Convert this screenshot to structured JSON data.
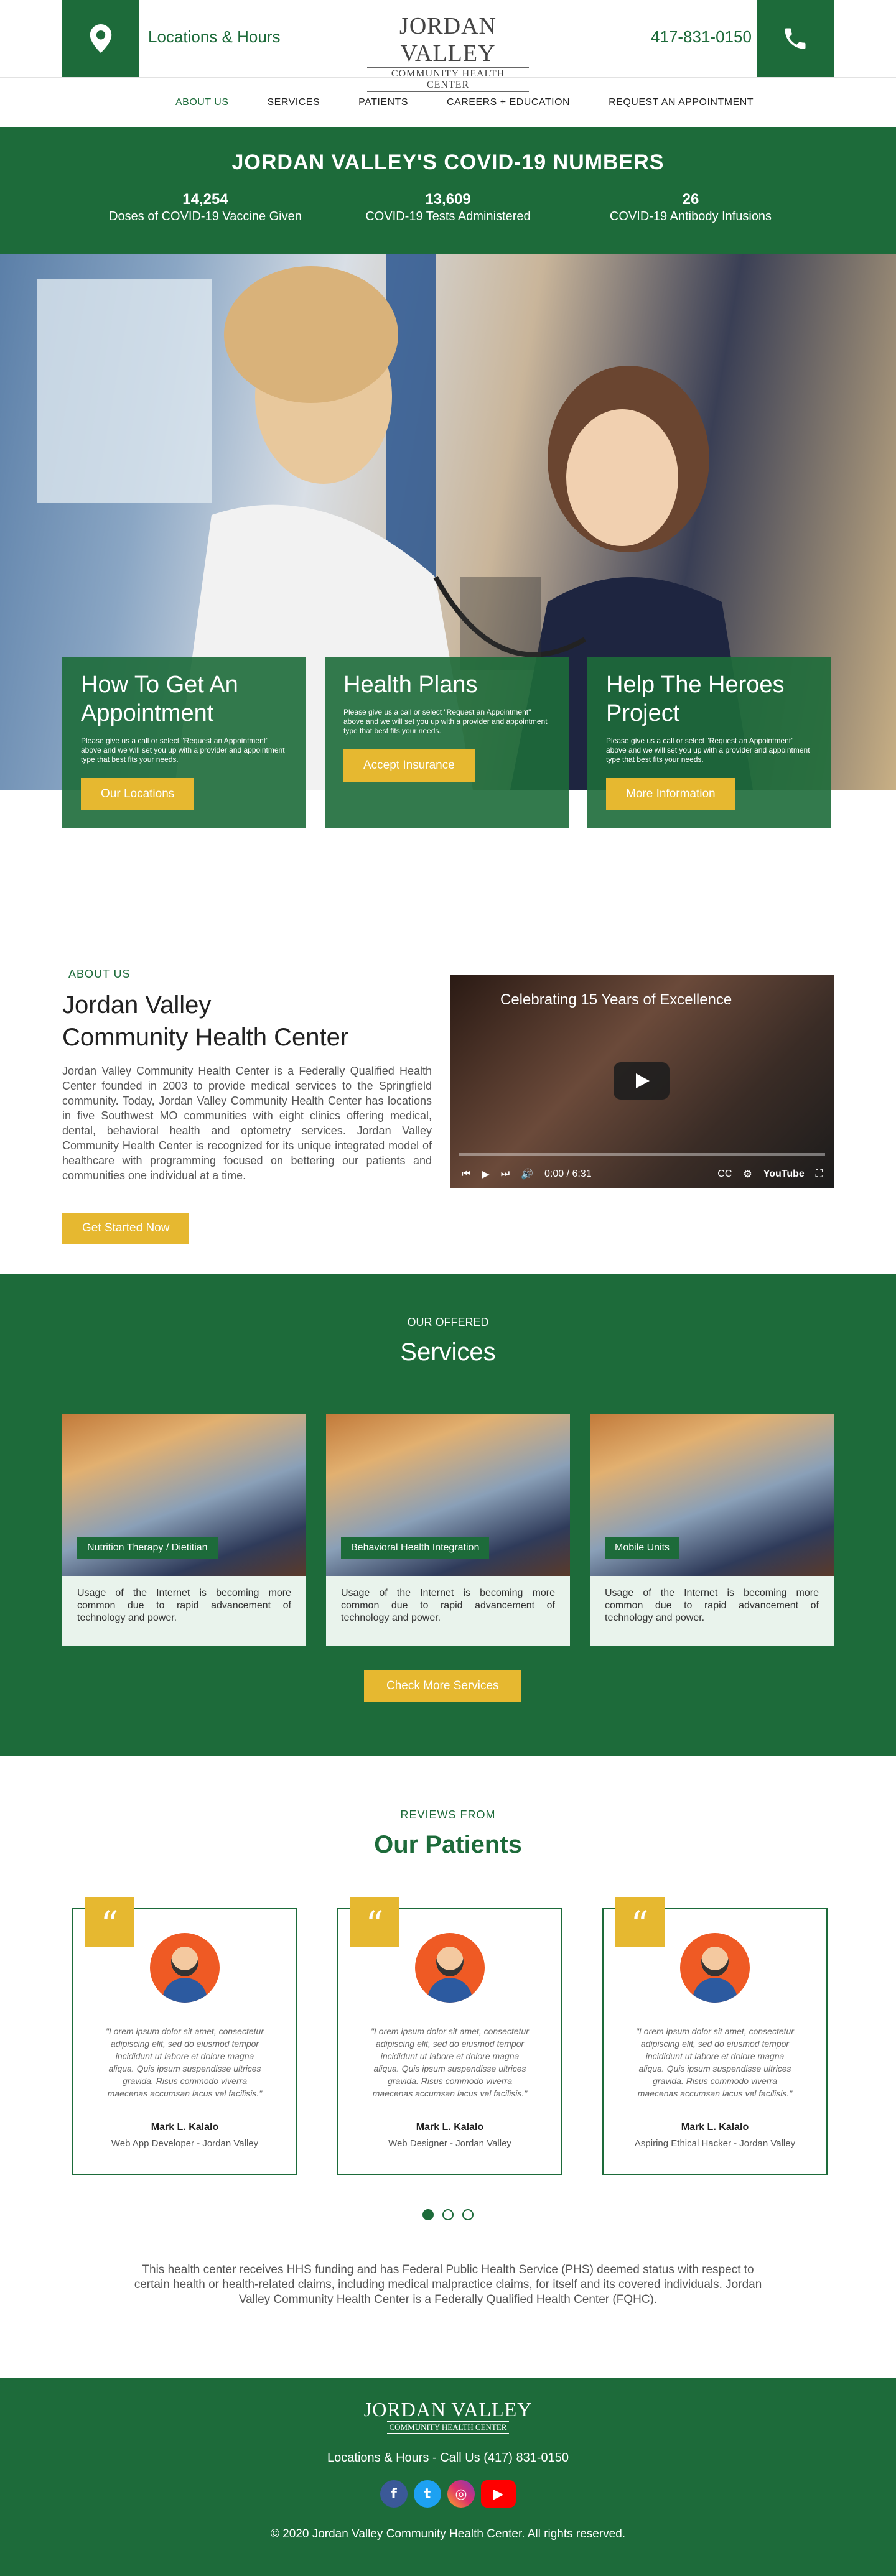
{
  "header": {
    "locations_label": "Locations & Hours",
    "logo_line1": "JORDAN VALLEY",
    "logo_line2": "COMMUNITY HEALTH CENTER",
    "phone": "417-831-0150"
  },
  "nav": {
    "items": [
      "ABOUT US",
      "SERVICES",
      "PATIENTS",
      "CAREERS + EDUCATION",
      "REQUEST AN APPOINTMENT"
    ]
  },
  "covid": {
    "title": "JORDAN VALLEY'S COVID-19 NUMBERS",
    "stats": [
      {
        "value": "14,254",
        "label": "Doses of COVID-19 Vaccine Given"
      },
      {
        "value": "13,609",
        "label": "COVID-19 Tests Administered"
      },
      {
        "value": "26",
        "label": "COVID-19 Antibody Infusions"
      }
    ]
  },
  "hero": {
    "cards": [
      {
        "title": "How To Get An Appointment",
        "text": "Please give us a call or select \"Request an Appointment\" above and we will set you up with a provider and appointment type that best fits your needs.",
        "button": "Our Locations"
      },
      {
        "title": "Health Plans",
        "text": "Please give us a call or select \"Request an Appointment\" above and we will set you up with a provider and appointment type that best fits your needs.",
        "button": "Accept Insurance"
      },
      {
        "title": "Help The Heroes Project",
        "text": "Please give us a call or select \"Request an Appointment\" above and we will set you up with a provider and appointment type that best fits your needs.",
        "button": "More Information"
      }
    ]
  },
  "about": {
    "kicker": "ABOUT US",
    "title_line1": "Jordan Valley",
    "title_line2": "Community Health Center",
    "body": "Jordan Valley Community Health Center is a Federally Qualified Health Center founded in 2003 to provide medical services to the Springfield community.  Today, Jordan Valley Community Health Center has locations in five Southwest MO communities with eight clinics offering medical, dental, behavioral health and optometry services.  Jordan Valley Community Health Center is recognized for its unique integrated model of healthcare with programming focused on bettering our patients and communities one individual at a time.",
    "button": "Get Started Now",
    "video_title": "Celebrating 15 Years of Excellence",
    "video_time": "0:00 / 6:31",
    "video_brand": "YouTube"
  },
  "services": {
    "kicker": "OUR OFFERED",
    "title": "Services",
    "cards": [
      {
        "tag": "Nutrition Therapy / Dietitian",
        "text": "Usage of the Internet is becoming more common due to rapid advancement of technology and power."
      },
      {
        "tag": "Behavioral Health Integration",
        "text": "Usage of the Internet is becoming more common due to rapid advancement of technology and power."
      },
      {
        "tag": "Mobile Units",
        "text": "Usage of the Internet is becoming more common due to rapid advancement of technology and power."
      }
    ],
    "button": "Check More Services"
  },
  "reviews": {
    "kicker": "REVIEWS FROM",
    "title": "Our Patients",
    "items": [
      {
        "quote": "\"Lorem ipsum dolor sit amet, consectetur adipiscing elit, sed do eiusmod tempor incididunt ut labore et dolore magna aliqua. Quis ipsum suspendisse ultrices gravida. Risus commodo viverra maecenas accumsan lacus vel facilisis.\"",
        "name": "Mark L. Kalalo",
        "role": "Web App Developer - Jordan Valley"
      },
      {
        "quote": "\"Lorem ipsum dolor sit amet, consectetur adipiscing elit, sed do eiusmod tempor incididunt ut labore et dolore magna aliqua. Quis ipsum suspendisse ultrices gravida. Risus commodo viverra maecenas accumsan lacus vel facilisis.\"",
        "name": "Mark L. Kalalo",
        "role": "Web Designer - Jordan Valley"
      },
      {
        "quote": "\"Lorem ipsum dolor sit amet, consectetur adipiscing elit, sed do eiusmod tempor incididunt ut labore et dolore magna aliqua. Quis ipsum suspendisse ultrices gravida. Risus commodo viverra maecenas accumsan lacus vel facilisis.\"",
        "name": "Mark L. Kalalo",
        "role": "Aspiring Ethical Hacker - Jordan Valley"
      }
    ],
    "notice": "This health center receives HHS funding and has Federal Public Health Service (PHS) deemed status with respect to certain health or health-related claims, including medical malpractice claims, for itself and its covered individuals. Jordan Valley Community Health Center is  a Federally Qualified Health Center (FQHC)."
  },
  "footer": {
    "logo_line1": "JORDAN VALLEY",
    "logo_line2": "COMMUNITY HEALTH CENTER",
    "links": "Locations & Hours  -  Call Us (417) 831-0150",
    "copyright": "© 2020 Jordan Valley Community Health Center. All rights reserved.",
    "social": [
      "facebook-icon",
      "twitter-icon",
      "instagram-icon",
      "youtube-icon"
    ]
  },
  "colors": {
    "brand_green": "#1d6b3a",
    "accent_yellow": "#e6b830"
  }
}
